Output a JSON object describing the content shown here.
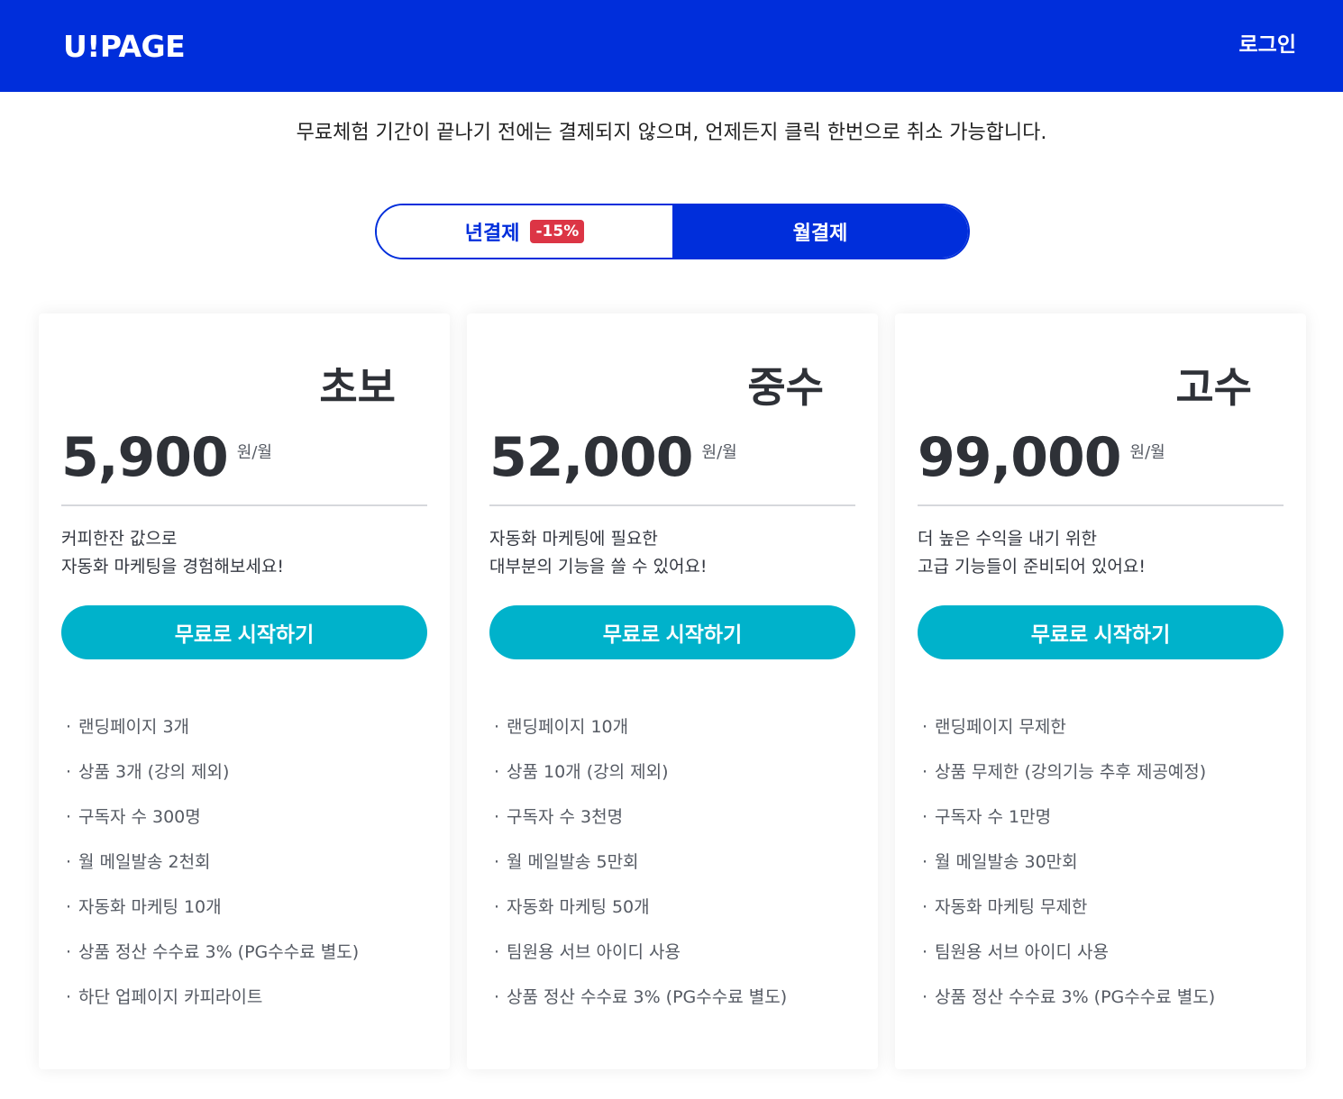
{
  "header": {
    "logo": "U!PAGE",
    "login_label": "로그인"
  },
  "notice": "무료체험 기간이 끝나기 전에는 결제되지 않으며, 언제든지 클릭 한번으로 취소 가능합니다.",
  "billing_toggle": {
    "yearly_label": "년결제",
    "yearly_discount": "-15%",
    "monthly_label": "월결제",
    "selected": "monthly"
  },
  "colors": {
    "brand": "#002edb",
    "cta": "#00b2cb",
    "discount_badge": "#dc3545"
  },
  "plans": [
    {
      "name": "초보",
      "price": "5,900",
      "unit": "원/월",
      "desc_line1": "커피한잔 값으로",
      "desc_line2": "자동화 마케팅을 경험해보세요!",
      "cta_label": "무료로 시작하기",
      "features": [
        "랜딩페이지 3개",
        "상품 3개 (강의 제외)",
        "구독자 수 300명",
        "월 메일발송 2천회",
        "자동화 마케팅 10개",
        "상품 정산 수수료 3% (PG수수료 별도)",
        "하단 업페이지 카피라이트"
      ]
    },
    {
      "name": "중수",
      "price": "52,000",
      "unit": "원/월",
      "desc_line1": "자동화 마케팅에 필요한",
      "desc_line2": "대부분의 기능을 쓸 수 있어요!",
      "cta_label": "무료로 시작하기",
      "features": [
        "랜딩페이지 10개",
        "상품 10개 (강의 제외)",
        "구독자 수 3천명",
        "월 메일발송 5만회",
        "자동화 마케팅 50개",
        "팀원용 서브 아이디 사용",
        "상품 정산 수수료 3% (PG수수료 별도)"
      ]
    },
    {
      "name": "고수",
      "price": "99,000",
      "unit": "원/월",
      "desc_line1": "더 높은 수익을 내기 위한",
      "desc_line2": "고급 기능들이 준비되어 있어요!",
      "cta_label": "무료로 시작하기",
      "features": [
        "랜딩페이지 무제한",
        "상품 무제한 (강의기능 추후 제공예정)",
        "구독자 수 1만명",
        "월 메일발송 30만회",
        "자동화 마케팅 무제한",
        "팀원용 서브 아이디 사용",
        "상품 정산 수수료 3% (PG수수료 별도)"
      ]
    }
  ]
}
